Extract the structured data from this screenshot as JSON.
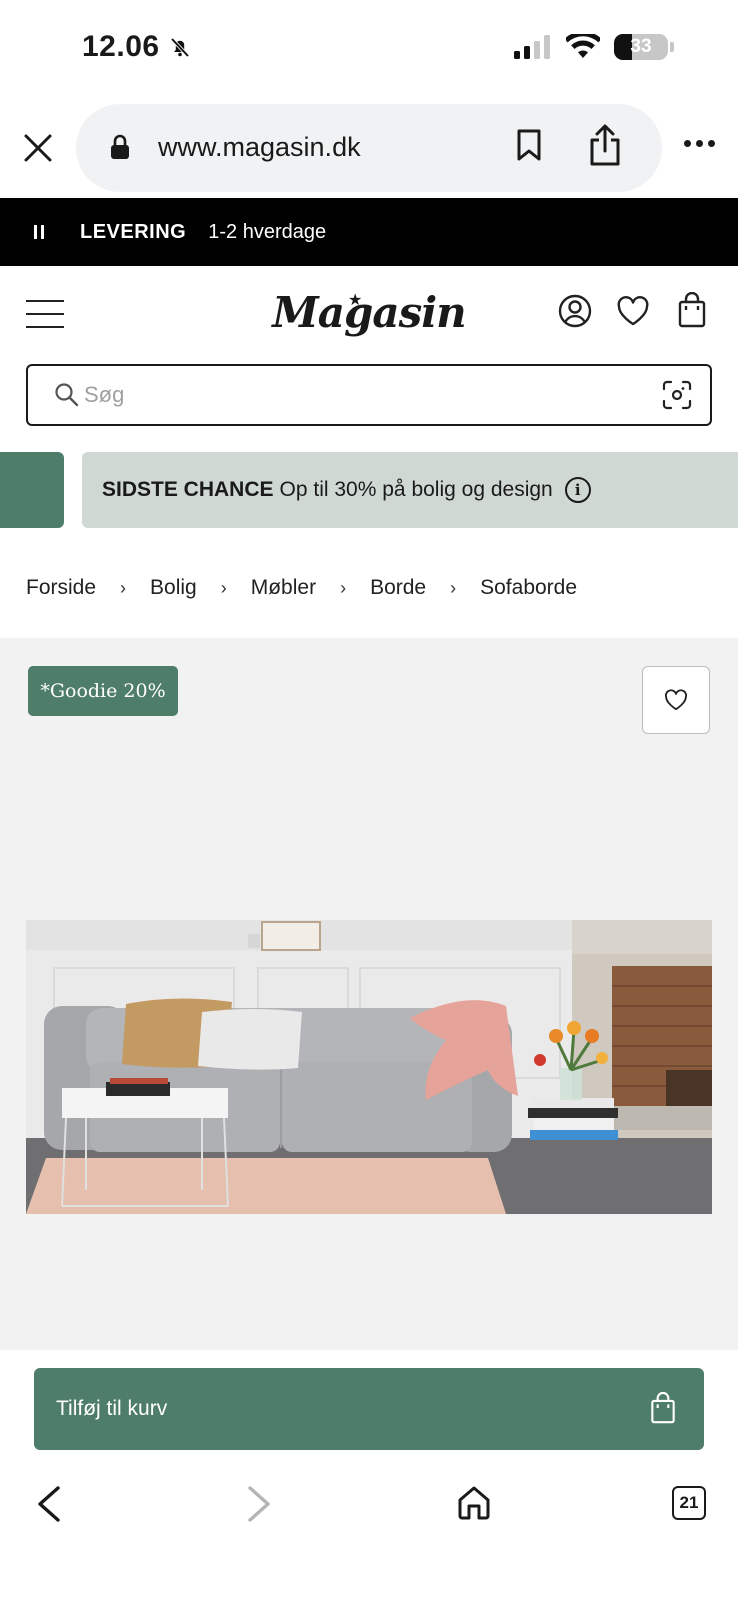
{
  "status_bar": {
    "time": "12.06",
    "battery": "33",
    "icons": [
      "silent-bell-icon",
      "signal-icon",
      "wifi-icon",
      "battery-icon"
    ]
  },
  "browser": {
    "url": "www.magasin.dk",
    "icons": [
      "close-icon",
      "lock-icon",
      "bookmark-icon",
      "share-icon",
      "more-icon"
    ]
  },
  "delivery": {
    "label": "LEVERING",
    "value": "1-2 hverdage"
  },
  "header": {
    "logo": "Magasin",
    "icons": [
      "menu-icon",
      "account-icon",
      "wishlist-icon",
      "bag-icon"
    ]
  },
  "search": {
    "placeholder": "Søg",
    "value": ""
  },
  "promo": {
    "bold": "SIDSTE CHANCE",
    "text": "Op til 30% på bolig og design",
    "info": "i"
  },
  "breadcrumb": {
    "items": [
      "Forside",
      "Bolig",
      "Møbler",
      "Borde",
      "Sofaborde"
    ],
    "separator": "›"
  },
  "product": {
    "badge": "*Goodie 20%"
  },
  "cart": {
    "label": "Tilføj til kurv"
  },
  "bottom_nav": {
    "tab_count": "21"
  },
  "colors": {
    "brand_green": "#4e7d6a",
    "promo_bg": "#cfd8d3",
    "delivery_bg": "#000000",
    "product_bg": "#f2f2f2"
  }
}
